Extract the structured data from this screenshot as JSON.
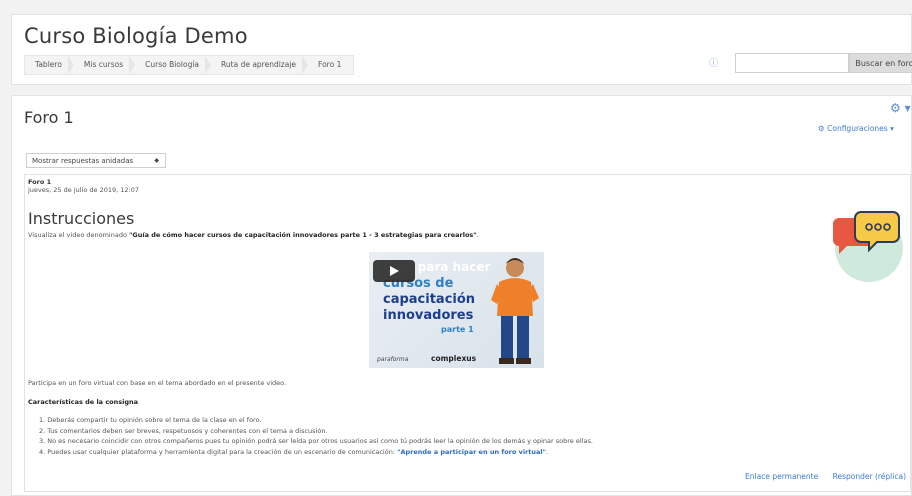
{
  "header": {
    "course_title": "Curso Biología Demo",
    "breadcrumb": [
      "Tablero",
      "Mis cursos",
      "Curso Biología",
      "Ruta de aprendizaje",
      "Foro 1"
    ],
    "search_placeholder": "",
    "search_button": "Buscar en foros"
  },
  "forum": {
    "title": "Foro 1",
    "config_label": "Configuraciones ▾",
    "display_mode": "Mostrar respuestas anidadas"
  },
  "post": {
    "subject": "Foro 1",
    "date": "jueves, 25 de julio de 2019, 12:07",
    "heading": "Instrucciones",
    "intro_prefix": "Visualiza el video denominado ",
    "intro_quote": "\"Guía de cómo hacer cursos de capacitación innovadores parte 1 - 3 estrategias para crearlos\"",
    "intro_suffix": ".",
    "video": {
      "line1": "Guía para hacer",
      "line2": "cursos de",
      "line3": "capacitación",
      "line4": "innovadores",
      "line5": "parte 1",
      "brand_left": "paraforma",
      "brand_right": "complexus"
    },
    "participate": "Participa en un foro virtual con base en el tema abordado en el presente video.",
    "characteristics_title": "Características de la consigna",
    "items": [
      "1. Deberás compartir tu opinión sobre el tema de la clase en el foro.",
      "2. Tus comentarios deben ser breves, respetuosos y coherentes con el tema a discusión.",
      "3. No es necesario coincidir con otros compañeros pues tu opinión podrá ser leída por otros usuarios así como tú podrás leer la opinión de los demás y opinar sobre ellas."
    ],
    "item4_prefix": "4. Puedes usar cualquier plataforma y herramienta digital para la creación de un escenario de comunicación: ",
    "item4_link": "\"Aprende a participar en un foro virtual\"",
    "item4_suffix": ".",
    "permalink": "Enlace permanente",
    "reply": "Responder (réplica)"
  },
  "colors": {
    "accent": "#3b7dd8",
    "chat_bubble": "#f7c948",
    "chat_circle": "#cfe9dc",
    "chat_back": "#e8573f"
  }
}
